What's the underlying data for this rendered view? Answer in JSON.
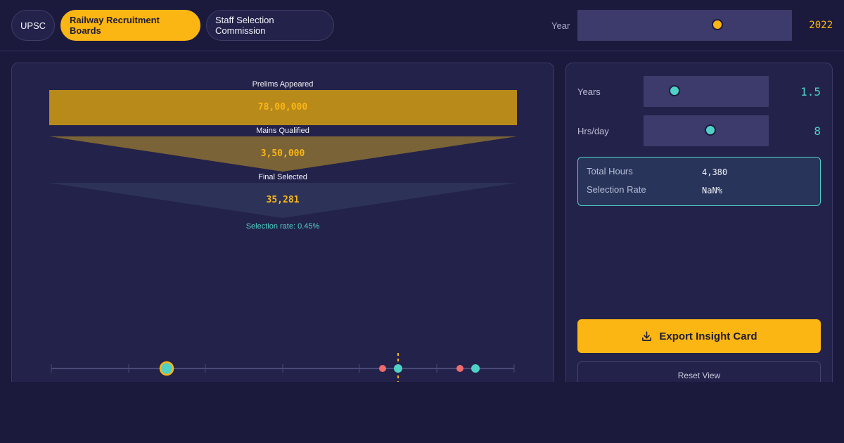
{
  "tabs": [
    {
      "label": "UPSC",
      "active": false
    },
    {
      "label": "Railway Recruitment Boards",
      "active": true
    },
    {
      "label": "Staff Selection Commission",
      "active": false
    }
  ],
  "year": {
    "label": "Year",
    "value": "2022",
    "slider_fraction": 0.65
  },
  "funnel": {
    "stages": [
      {
        "label": "Prelims Appeared",
        "value": "78,00,000"
      },
      {
        "label": "Mains Qualified",
        "value": "3,50,000"
      },
      {
        "label": "Final Selected",
        "value": "35,281"
      }
    ],
    "selection_rate": "Selection rate: 0.45%"
  },
  "controls": {
    "years": {
      "label": "Years",
      "value": "1.5",
      "slider_fraction": 0.25
    },
    "hrs_day": {
      "label": "Hrs/day",
      "value": "8",
      "slider_fraction": 0.55
    }
  },
  "stats": {
    "total_hours_label": "Total Hours",
    "total_hours_value": "4,380",
    "selection_rate_label": "Selection Rate",
    "selection_rate_value": "NaN%"
  },
  "buttons": {
    "export": "Export Insight Card",
    "reset": "Reset View"
  },
  "colors": {
    "accent": "#fbb613",
    "teal": "#4fd1c5",
    "coral": "#f06b6b",
    "background": "#1b1a3d"
  },
  "icons": {
    "export": "download-icon"
  }
}
